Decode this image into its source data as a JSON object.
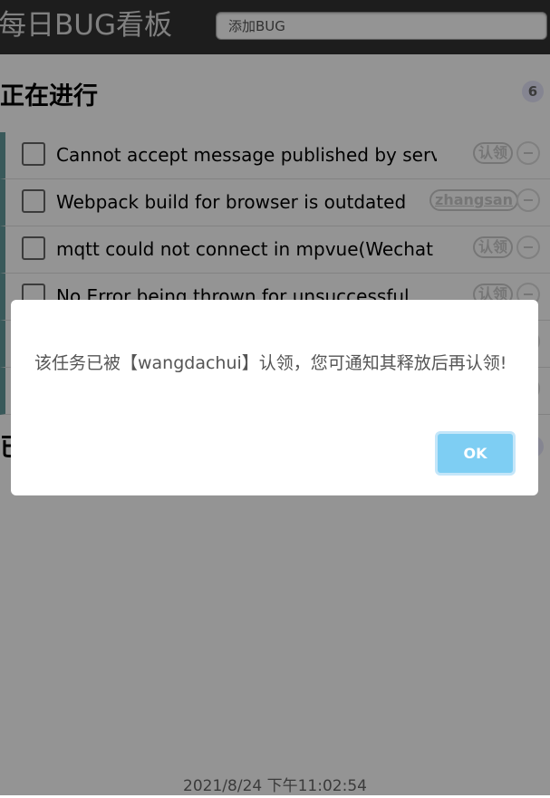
{
  "header": {
    "title": "每日BUG看板",
    "add_placeholder": "添加BUG"
  },
  "in_progress": {
    "title": "正在进行",
    "count": "6",
    "items": [
      {
        "text": "Cannot accept message published by server",
        "claim": "认领"
      },
      {
        "text": "Webpack build for browser is outdated",
        "claim": "zhangsan"
      },
      {
        "text": "mqtt could not connect in mpvue(Wechat",
        "claim": "认领"
      },
      {
        "text": "No Error being thrown for unsuccessful",
        "claim": "认领"
      },
      {
        "text": "",
        "claim": ""
      },
      {
        "text": "",
        "claim": ""
      }
    ]
  },
  "completed": {
    "title": "已",
    "count": ""
  },
  "footer": {
    "time": "2021/8/24 下午11:02:54"
  },
  "dialog": {
    "message": "该任务已被【wangdachui】认领，您可通知其释放后再认领!",
    "ok_label": "OK"
  },
  "colors": {
    "header_bg": "#333333",
    "item_accent": "#629a9c",
    "ok_button": "#7ecef3"
  }
}
